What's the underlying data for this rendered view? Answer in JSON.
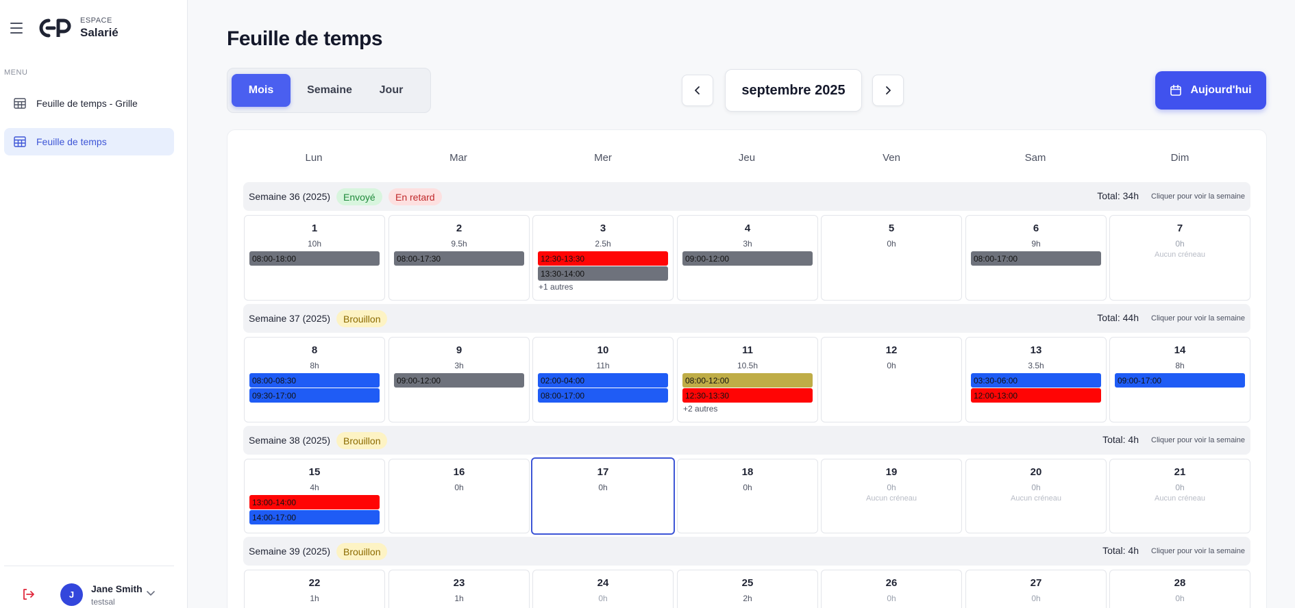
{
  "sidebar": {
    "brand_small": "ESPACE",
    "brand_big": "Salarié",
    "menu_label": "MENU",
    "items": [
      {
        "label": "Feuille de temps - Grille"
      },
      {
        "label": "Feuille de temps"
      }
    ],
    "user": {
      "initial": "J",
      "name": "Jane Smith",
      "login": "testsal"
    }
  },
  "header": {
    "title": "Feuille de temps",
    "views": [
      "Mois",
      "Semaine",
      "Jour"
    ],
    "active_view": "Mois",
    "month": "septembre 2025",
    "today_label": "Aujourd'hui"
  },
  "calendar": {
    "weekdays": [
      "Lun",
      "Mar",
      "Mer",
      "Jeu",
      "Ven",
      "Sam",
      "Dim"
    ],
    "link_label": "Cliquer pour voir la semaine",
    "weeks": [
      {
        "title": "Semaine 36 (2025)",
        "badges": [
          "Envoyé",
          "En retard"
        ],
        "total": "Total: 34h",
        "days": [
          {
            "num": "1",
            "hours": "10h",
            "slots": [
              "08:00-18:00"
            ]
          },
          {
            "num": "2",
            "hours": "9.5h",
            "slots": [
              "08:00-17:30"
            ]
          },
          {
            "num": "3",
            "hours": "2.5h",
            "slots": [
              "12:30-13:30",
              "13:30-14:00"
            ],
            "more": "+1 autres"
          },
          {
            "num": "4",
            "hours": "3h",
            "slots": [
              "09:00-12:00"
            ]
          },
          {
            "num": "5",
            "hours": "0h",
            "slots": []
          },
          {
            "num": "6",
            "hours": "9h",
            "slots": [
              "08:00-17:00"
            ]
          },
          {
            "num": "7",
            "hours": "0h",
            "slots": [],
            "empty": "Aucun créneau"
          }
        ]
      },
      {
        "title": "Semaine 37 (2025)",
        "badges": [
          "Brouillon"
        ],
        "total": "Total: 44h",
        "days": [
          {
            "num": "8",
            "hours": "8h",
            "slots": [
              "08:00-08:30",
              "09:30-17:00"
            ]
          },
          {
            "num": "9",
            "hours": "3h",
            "slots": [
              "09:00-12:00"
            ]
          },
          {
            "num": "10",
            "hours": "11h",
            "slots": [
              "02:00-04:00",
              "08:00-17:00"
            ]
          },
          {
            "num": "11",
            "hours": "10.5h",
            "slots": [
              "08:00-12:00",
              "12:30-13:30"
            ],
            "more": "+2 autres"
          },
          {
            "num": "12",
            "hours": "0h",
            "slots": []
          },
          {
            "num": "13",
            "hours": "3.5h",
            "slots": [
              "03:30-06:00",
              "12:00-13:00"
            ]
          },
          {
            "num": "14",
            "hours": "8h",
            "slots": [
              "09:00-17:00"
            ]
          }
        ]
      },
      {
        "title": "Semaine 38 (2025)",
        "badges": [
          "Brouillon"
        ],
        "total": "Total: 4h",
        "days": [
          {
            "num": "15",
            "hours": "4h",
            "slots": [
              "13:00-14:00",
              "14:00-17:00"
            ]
          },
          {
            "num": "16",
            "hours": "0h",
            "slots": []
          },
          {
            "num": "17",
            "hours": "0h",
            "slots": [],
            "today": true
          },
          {
            "num": "18",
            "hours": "0h",
            "slots": []
          },
          {
            "num": "19",
            "hours": "0h",
            "slots": [],
            "empty": "Aucun créneau"
          },
          {
            "num": "20",
            "hours": "0h",
            "slots": [],
            "empty": "Aucun créneau"
          },
          {
            "num": "21",
            "hours": "0h",
            "slots": [],
            "empty": "Aucun créneau"
          }
        ]
      },
      {
        "title": "Semaine 39 (2025)",
        "badges": [
          "Brouillon"
        ],
        "total": "Total: 4h",
        "days": [
          {
            "num": "22",
            "hours": "1h"
          },
          {
            "num": "23",
            "hours": "1h"
          },
          {
            "num": "24",
            "hours": "0h"
          },
          {
            "num": "25",
            "hours": "2h"
          },
          {
            "num": "26",
            "hours": "0h"
          },
          {
            "num": "27",
            "hours": "0h"
          },
          {
            "num": "28",
            "hours": "0h"
          }
        ]
      }
    ]
  },
  "colors": {
    "accent": "#4052ee",
    "slot_grey": "#6e727c",
    "slot_red": "#ff0505",
    "slot_blue": "#1f5cf5",
    "slot_olive": "#bfad47"
  }
}
